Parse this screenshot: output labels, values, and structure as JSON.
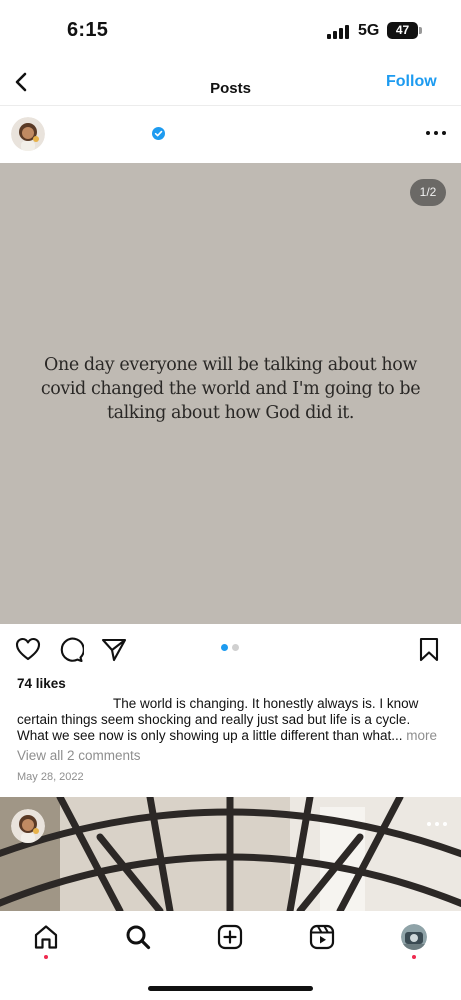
{
  "status_bar": {
    "time": "6:15",
    "network": "5G",
    "battery": "47"
  },
  "header": {
    "title": "Posts",
    "follow_label": "Follow"
  },
  "post": {
    "page_indicator": "1/2",
    "image_quote": "One day everyone will be talking about how covid changed the world and I'm going to be talking about how God did it.",
    "likes": "74 likes",
    "caption_line1": "The world is changing. It honestly always is. I know",
    "caption_line2": "certain things seem shocking and really just sad but life is a cycle.",
    "caption_line3": "What we see now is only showing up a little different than what...",
    "caption_more": "more",
    "view_comments": "View all 2 comments",
    "date": "May 28, 2022",
    "carousel_active_index": 0,
    "carousel_count": 2
  },
  "colors": {
    "accent": "#1d9bf0",
    "image_background": "#bfbab3",
    "muted_text": "#8e8e8e",
    "notification_dot": "#ef2a4f"
  },
  "icons": {
    "back": "chevron-left-icon",
    "verified": "verified-badge-icon",
    "more": "ellipsis-icon",
    "like": "heart-icon",
    "comment": "comment-bubble-icon",
    "share": "paper-plane-icon",
    "save": "bookmark-icon",
    "tabs": [
      "home-icon",
      "search-icon",
      "create-icon",
      "reels-icon",
      "profile-avatar"
    ]
  }
}
